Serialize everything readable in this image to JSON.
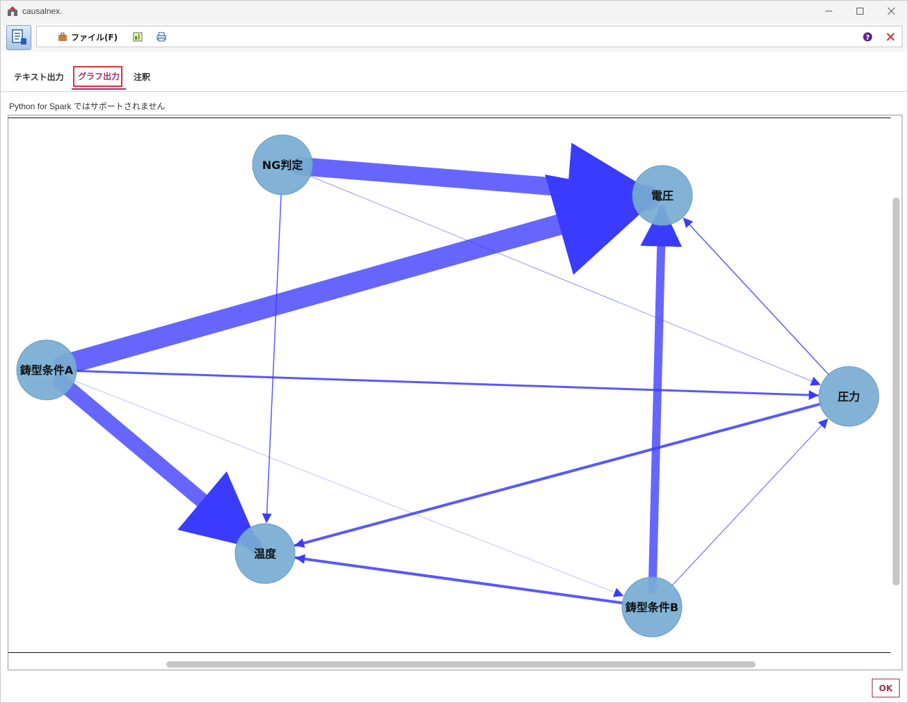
{
  "window": {
    "title": "causalnex.",
    "minimize_icon": "minimize-icon",
    "maximize_icon": "maximize-icon",
    "close_icon": "close-icon"
  },
  "toolbar": {
    "file_menu_label": "ファイル(F)",
    "file_icon": "briefcase-icon",
    "export_icon": "export-image-icon",
    "print_icon": "printer-icon",
    "help_icon": "help-icon",
    "close_icon": "red-x-icon"
  },
  "tabs": [
    {
      "label": "テキスト出力",
      "active": false
    },
    {
      "label": "グラフ出力",
      "active": true
    },
    {
      "label": "注釈",
      "active": false
    }
  ],
  "notice": "Python for Spark ではサポートされません",
  "graph": {
    "node_color": "#77acd2",
    "edge_color": "#3b3bff",
    "nodes": [
      {
        "id": "ng",
        "label": "NG判定"
      },
      {
        "id": "voltage",
        "label": "電圧"
      },
      {
        "id": "moldA",
        "label": "鋳型条件A"
      },
      {
        "id": "pressure",
        "label": "圧力"
      },
      {
        "id": "temperature",
        "label": "温度"
      },
      {
        "id": "moldB",
        "label": "鋳型条件B"
      }
    ],
    "edges": [
      {
        "from": "ng",
        "to": "voltage",
        "weight": 26
      },
      {
        "from": "moldA",
        "to": "voltage",
        "weight": 30
      },
      {
        "from": "moldA",
        "to": "temperature",
        "weight": 22
      },
      {
        "from": "moldB",
        "to": "voltage",
        "weight": 12
      },
      {
        "from": "moldA",
        "to": "pressure",
        "weight": 3
      },
      {
        "from": "pressure",
        "to": "temperature",
        "weight": 4
      },
      {
        "from": "moldB",
        "to": "temperature",
        "weight": 4
      },
      {
        "from": "ng",
        "to": "temperature",
        "weight": 1.5
      },
      {
        "from": "pressure",
        "to": "voltage",
        "weight": 1.5
      },
      {
        "from": "moldB",
        "to": "pressure",
        "weight": 1
      },
      {
        "from": "ng",
        "to": "pressure",
        "weight": 0.6
      },
      {
        "from": "moldA",
        "to": "moldB",
        "weight": 0.4
      }
    ]
  },
  "ok_button": "OK"
}
